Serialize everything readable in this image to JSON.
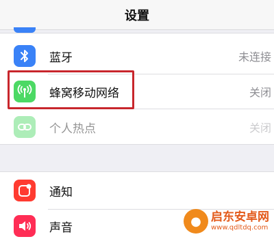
{
  "header": {
    "title": "设置"
  },
  "group1": {
    "items": [
      {
        "label": "蓝牙",
        "value": "未连接",
        "icon": "bluetooth-icon",
        "color": "#3a82f7"
      },
      {
        "label": "蜂窝移动网络",
        "value": "关闭",
        "icon": "cellular-antenna-icon",
        "color": "#4cd964"
      },
      {
        "label": "个人热点",
        "value": "关闭",
        "icon": "personal-hotspot-icon",
        "color": "#4cd964"
      }
    ]
  },
  "group2": {
    "items": [
      {
        "label": "通知",
        "icon": "notifications-icon",
        "color": "#ff3b30"
      },
      {
        "label": "声音",
        "icon": "sounds-icon",
        "color": "#ff2d55"
      }
    ]
  },
  "highlight": {
    "color": "#c8262c"
  },
  "watermark": {
    "title": "启东安卓网",
    "url": "www.qdltdq.com"
  }
}
